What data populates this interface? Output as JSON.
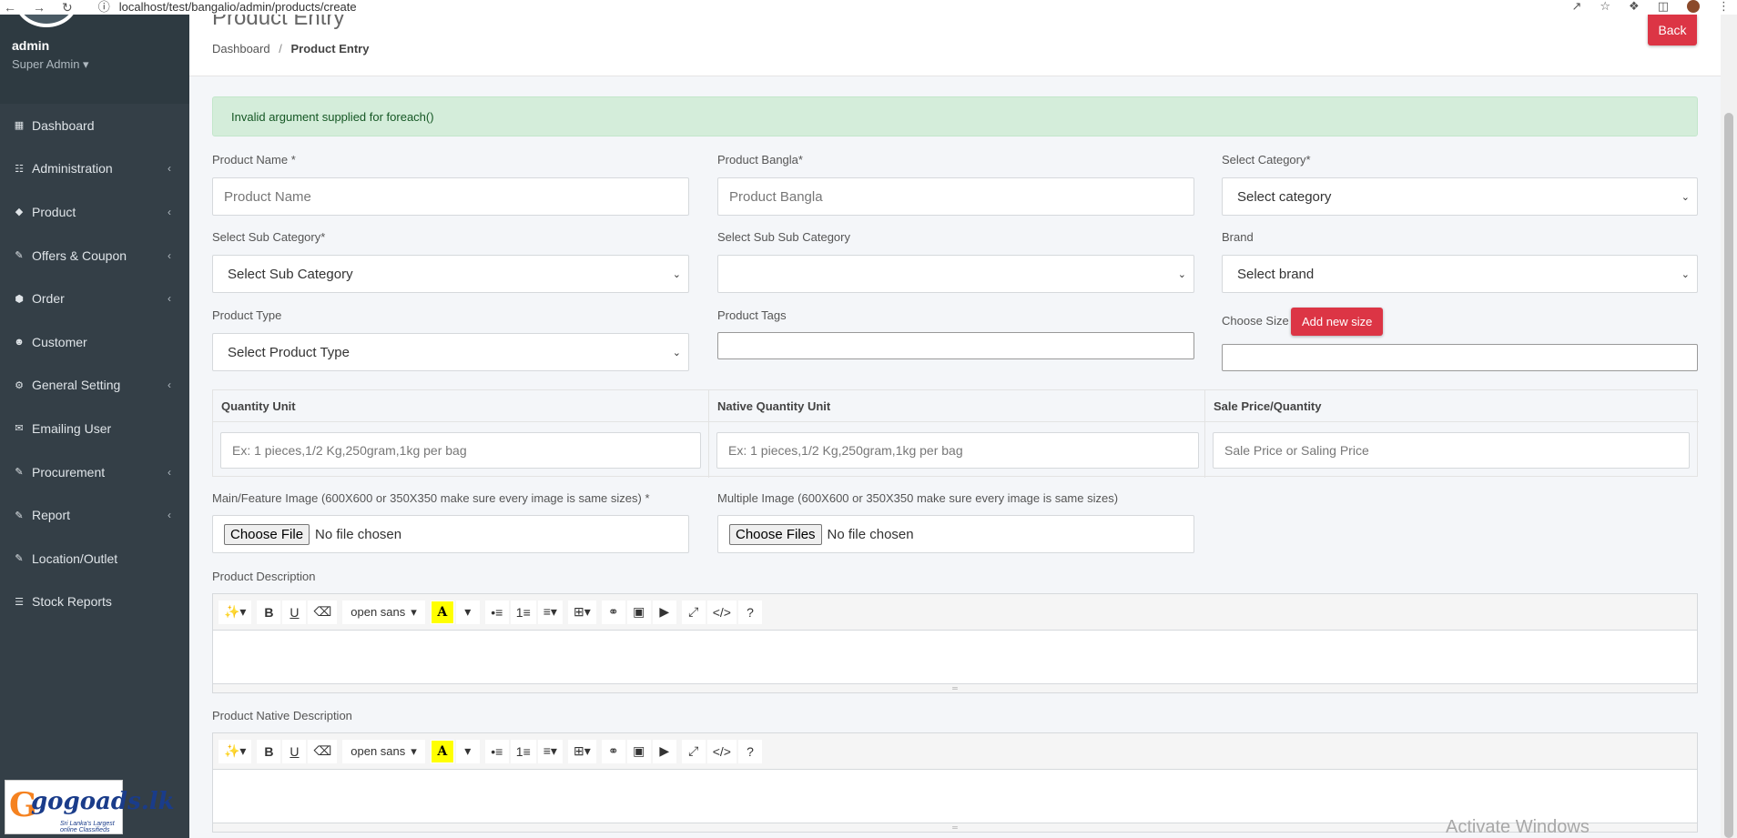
{
  "browser": {
    "url": "localhost/test/bangalio/admin/products/create"
  },
  "sidebar": {
    "user_name": "admin",
    "user_role": "Super Admin ▾",
    "items": [
      {
        "label": "Dashboard",
        "icon": "dashboard-icon",
        "glyph": "▦",
        "chevron": ""
      },
      {
        "label": "Administration",
        "icon": "sitemap-icon",
        "glyph": "☷",
        "chevron": "‹"
      },
      {
        "label": "Product",
        "icon": "diamond-icon",
        "glyph": "◆",
        "chevron": "‹"
      },
      {
        "label": "Offers & Coupon",
        "icon": "pencil-icon",
        "glyph": "✎",
        "chevron": "‹"
      },
      {
        "label": "Order",
        "icon": "cube-icon",
        "glyph": "⬢",
        "chevron": "‹"
      },
      {
        "label": "Customer",
        "icon": "users-icon",
        "glyph": "☻",
        "chevron": ""
      },
      {
        "label": "General Setting",
        "icon": "gear-icon",
        "glyph": "⚙",
        "chevron": "‹"
      },
      {
        "label": "Emailing User",
        "icon": "envelope-icon",
        "glyph": "✉",
        "chevron": ""
      },
      {
        "label": "Procurement",
        "icon": "pencil-icon",
        "glyph": "✎",
        "chevron": "‹"
      },
      {
        "label": "Report",
        "icon": "pencil-icon",
        "glyph": "✎",
        "chevron": "‹"
      },
      {
        "label": "Location/Outlet",
        "icon": "pencil-icon",
        "glyph": "✎",
        "chevron": ""
      },
      {
        "label": "Stock Reports",
        "icon": "list-icon",
        "glyph": "☰",
        "chevron": ""
      }
    ],
    "logo": {
      "g": "G",
      "text": "gogoads.lk",
      "tagline": "Sri Lanka's Largest online Classifieds"
    }
  },
  "header": {
    "title": "Product Entry",
    "breadcrumb_home": "Dashboard",
    "breadcrumb_sep": "/",
    "breadcrumb_current": "Product Entry",
    "back_label": "Back"
  },
  "alert": {
    "message": "Invalid argument supplied for foreach()"
  },
  "form": {
    "product_name_label": "Product Name *",
    "product_name_placeholder": "Product Name",
    "product_bangla_label": "Product Bangla*",
    "product_bangla_placeholder": "Product Bangla",
    "category_label": "Select Category*",
    "category_value": "Select category",
    "sub_category_label": "Select Sub Category*",
    "sub_category_value": "Select Sub Category",
    "sub_sub_category_label": "Select Sub Sub Category",
    "sub_sub_category_value": "",
    "brand_label": "Brand",
    "brand_value": "Select brand",
    "product_type_label": "Product Type",
    "product_type_value": "Select Product Type",
    "product_tags_label": "Product Tags",
    "choose_size_label": "Choose Size",
    "add_size_label": "Add new size",
    "quantity_unit_header": "Quantity Unit",
    "quantity_unit_placeholder": "Ex: 1 pieces,1/2 Kg,250gram,1kg per bag",
    "native_quantity_header": "Native Quantity Unit",
    "native_quantity_placeholder": "Ex: 1 pieces,1/2 Kg,250gram,1kg per bag",
    "sale_price_header": "Sale Price/Quantity",
    "sale_price_placeholder": "Sale Price or Saling Price",
    "main_image_label": "Main/Feature Image (600X600 or 350X350 make sure every image is same sizes) *",
    "main_image_button": "Choose File",
    "main_image_status": "No file chosen",
    "multi_image_label": "Multiple Image (600X600 or 350X350 make sure every image is same sizes)",
    "multi_image_button": "Choose Files",
    "multi_image_status": "No file chosen",
    "description_label": "Product Description",
    "native_description_label": "Product Native Description"
  },
  "editor": {
    "font_name": "open sans",
    "highlight_glyph": "A"
  },
  "watermark": "Activate Windows"
}
